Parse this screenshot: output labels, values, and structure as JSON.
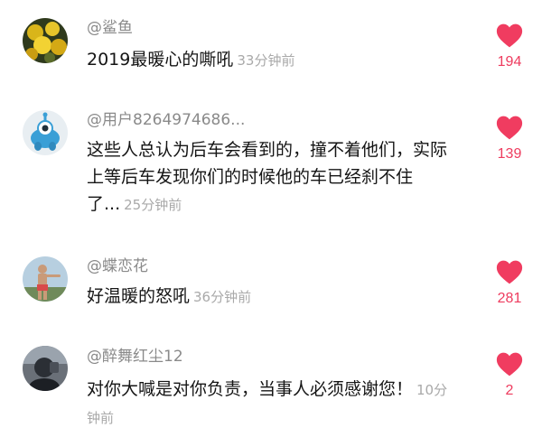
{
  "colors": {
    "heart": "#f03c60",
    "count": "#ee3b5e",
    "username": "#8a8a8a",
    "time": "#a9a9a9",
    "text": "#151515"
  },
  "comments": [
    {
      "username": "@鲨鱼",
      "text": "2019最暖心的嘶吼",
      "time": "33分钟前",
      "likes": "194",
      "avatar": "yellow-flowers-avatar",
      "like_icon": "heart-icon"
    },
    {
      "username": "@用户8264974686...",
      "text": "这些人总认为后车会看到的，撞不着他们，实际上等后车发现你们的时候他的车已经刹不住了...",
      "time": "25分钟前",
      "likes": "139",
      "avatar": "cartoon-monster-avatar",
      "like_icon": "heart-icon"
    },
    {
      "username": "@蝶恋花",
      "text": "好温暖的怒吼",
      "time": "36分钟前",
      "likes": "281",
      "avatar": "man-outdoors-avatar",
      "like_icon": "heart-icon"
    },
    {
      "username": "@醉舞红尘12",
      "text": "对你大喊是对你负责，当事人必须感谢您！",
      "time": "10分钟前",
      "likes": "2",
      "avatar": "person-selfie-avatar",
      "like_icon": "heart-icon"
    }
  ]
}
